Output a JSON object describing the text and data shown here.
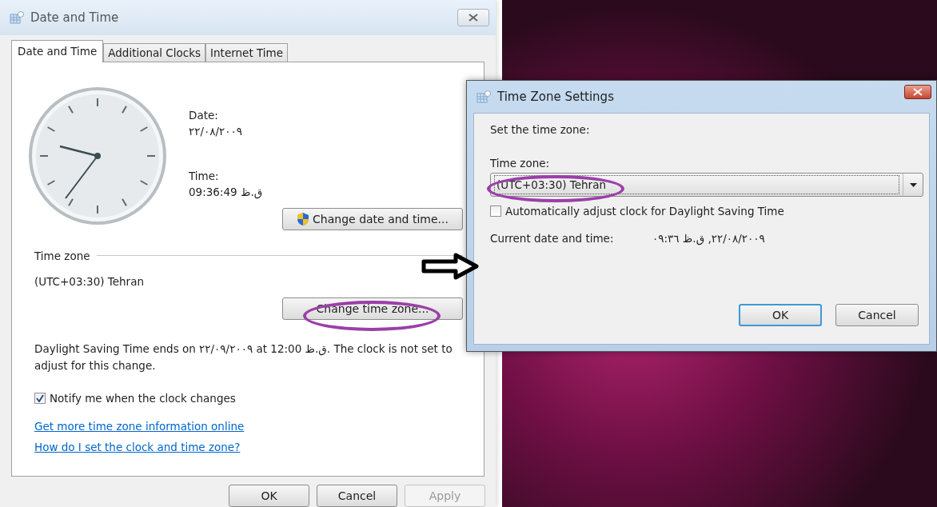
{
  "dialog": {
    "title": "Date and Time",
    "tabs": [
      {
        "label": "Date and Time",
        "selected": true
      },
      {
        "label": "Additional Clocks",
        "selected": false
      },
      {
        "label": "Internet Time",
        "selected": false
      }
    ],
    "date_label": "Date:",
    "date_value": "٢٢/٠٨/٢٠٠٩",
    "time_label": "Time:",
    "time_value": "09:36:49 ق.ظ",
    "change_date_button": "Change date and time...",
    "time_zone_heading": "Time zone",
    "time_zone_value": "(UTC+03:30) Tehran",
    "change_zone_button": "Change time zone...",
    "dst_notice": "Daylight Saving Time ends on ٢٢/٠٩/٢٠٠٩ at 12:00 ق.ظ. The clock is not set to adjust for this change.",
    "notify_checkbox": {
      "label": "Notify me when the clock changes",
      "checked": true
    },
    "links": [
      "Get more time zone information online",
      "How do I set the clock and time zone?"
    ],
    "buttons": [
      {
        "label": "OK",
        "disabled": false
      },
      {
        "label": "Cancel",
        "disabled": false
      },
      {
        "label": "Apply",
        "disabled": true
      }
    ]
  },
  "time_zone_dialog": {
    "title": "Time Zone Settings",
    "prompt": "Set the time zone:",
    "time_zone_label": "Time zone:",
    "time_zone_select": {
      "value": "(UTC+03:30) Tehran"
    },
    "auto_dst_checkbox": {
      "label": "Automatically adjust clock for Daylight Saving Time",
      "checked": false
    },
    "current_label": "Current date and time:",
    "current_value": "٢٢/٠٨/٢٠٠٩, ق.ظ ٠٩:٣٦",
    "buttons": [
      {
        "label": "OK",
        "default": true
      },
      {
        "label": "Cancel",
        "default": false
      }
    ]
  }
}
